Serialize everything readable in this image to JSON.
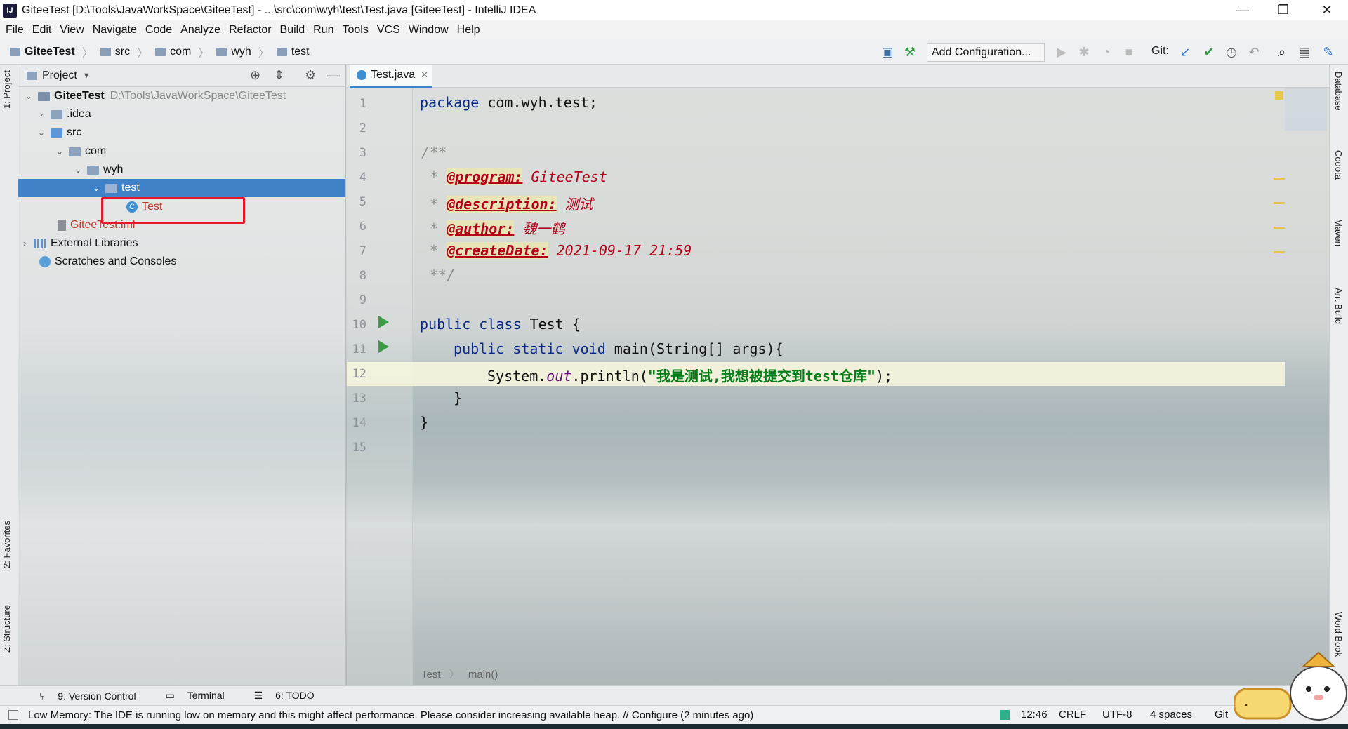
{
  "window": {
    "title": "GiteeTest [D:\\Tools\\JavaWorkSpace\\GiteeTest] - ...\\src\\com\\wyh\\test\\Test.java [GiteeTest] - IntelliJ IDEA",
    "app_icon": "IJ"
  },
  "menu": [
    "File",
    "Edit",
    "View",
    "Navigate",
    "Code",
    "Analyze",
    "Refactor",
    "Build",
    "Run",
    "Tools",
    "VCS",
    "Window",
    "Help"
  ],
  "breadcrumb": [
    "GiteeTest",
    "src",
    "com",
    "wyh",
    "test"
  ],
  "toolbar": {
    "add_config": "Add Configuration...",
    "git_label": "Git:"
  },
  "left_tabs": {
    "project": "1: Project",
    "favorites": "2: Favorites",
    "structure": "Z: Structure"
  },
  "right_tabs": [
    "Database",
    "Codota",
    "Maven",
    "Ant Build",
    "Word Book"
  ],
  "project": {
    "title": "Project",
    "tree": [
      {
        "label": "GiteeTest",
        "hint": "D:\\Tools\\JavaWorkSpace\\GiteeTest"
      },
      {
        "label": ".idea"
      },
      {
        "label": "src"
      },
      {
        "label": "com"
      },
      {
        "label": "wyh"
      },
      {
        "label": "test"
      },
      {
        "label": "Test"
      },
      {
        "label": "GiteeTest.iml"
      },
      {
        "label": "External Libraries"
      },
      {
        "label": "Scratches and Consoles"
      }
    ]
  },
  "editor": {
    "tab": "Test.java",
    "line_numbers": [
      "1",
      "2",
      "3",
      "4",
      "5",
      "6",
      "7",
      "8",
      "9",
      "10",
      "11",
      "12",
      "13",
      "14",
      "15"
    ],
    "code": {
      "l1_kw": "package",
      "l1_rest": " com.wyh.test;",
      "l3": "/**",
      "l4_tag": "@program:",
      "l4_val": " GiteeTest",
      "l5_tag": "@description:",
      "l5_val": " 测试",
      "l6_tag": "@author:",
      "l6_val": " 魏一鹤",
      "l7_tag": "@createDate:",
      "l7_val": " 2021-09-17 21:59",
      "l8": "**/",
      "l10_kw": "public class",
      "l10_rest": " Test {",
      "l11_kw": "public static void",
      "l11_rest": " main(String[] args){",
      "l12_a": "System.",
      "l12_field": "out",
      "l12_b": ".println(",
      "l12_str": "\"我是测试,我想被提交到test仓库\"",
      "l12_c": ");",
      "l13": "}",
      "l14": "}"
    },
    "breadcrumb_bottom": [
      "Test",
      "main()"
    ]
  },
  "toolwindows": [
    "9: Version Control",
    "Terminal",
    "6: TODO"
  ],
  "status": {
    "message": "Low Memory: The IDE is running low on memory and this might affect performance. Please consider increasing available heap. // Configure (2 minutes ago)",
    "position": "12:46",
    "line_sep": "CRLF",
    "encoding": "UTF-8",
    "indent": "4 spaces",
    "vcs": "Git"
  },
  "colors": {
    "accent": "#3f82c7",
    "highlight_box": "#e8182a",
    "run_icon": "#3d9b48"
  }
}
